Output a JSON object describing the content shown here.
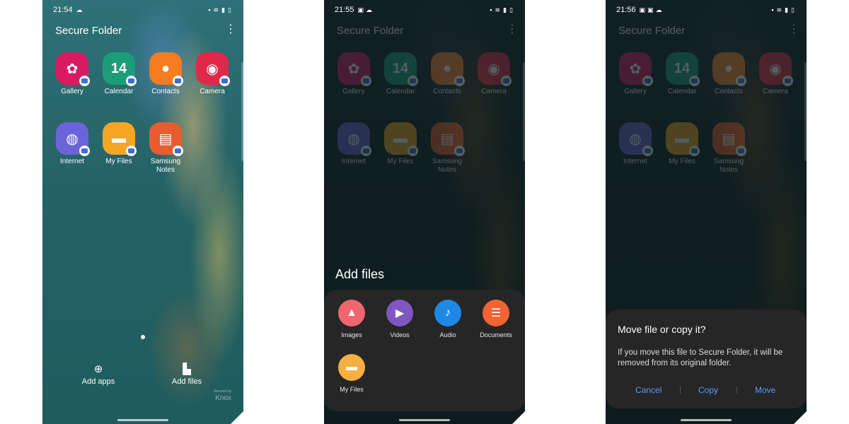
{
  "screen1": {
    "time": "21:54",
    "title": "Secure Folder",
    "apps": [
      {
        "label": "Gallery",
        "icon": "gallery-icon",
        "color": "#d81b60"
      },
      {
        "label": "Calendar",
        "icon": "calendar-icon",
        "color": "#1b9e77",
        "glyph": "14"
      },
      {
        "label": "Contacts",
        "icon": "contacts-icon",
        "color": "#f57c20"
      },
      {
        "label": "Camera",
        "icon": "camera-icon",
        "color": "#e0284a"
      },
      {
        "label": "Internet",
        "icon": "internet-icon",
        "color": "#6c63d8"
      },
      {
        "label": "My Files",
        "icon": "folder-icon",
        "color": "#f5a623"
      },
      {
        "label": "Samsung Notes",
        "label_lines": [
          "Samsung",
          "Notes"
        ],
        "icon": "notes-icon",
        "color": "#e85d2f"
      }
    ],
    "add_apps": "Add apps",
    "add_files": "Add files",
    "knox_small": "Secured by",
    "knox": "Knox"
  },
  "screen2": {
    "time": "21:55",
    "sheet_title": "Add files",
    "options": [
      {
        "label": "Images",
        "icon": "images-icon",
        "color": "#ef6670"
      },
      {
        "label": "Videos",
        "icon": "videos-icon",
        "color": "#7e57c2"
      },
      {
        "label": "Audio",
        "icon": "audio-icon",
        "color": "#1e88e5"
      },
      {
        "label": "Documents",
        "icon": "documents-icon",
        "color": "#f06434"
      },
      {
        "label": "My Files",
        "icon": "folder-icon",
        "color": "#f5b041"
      }
    ]
  },
  "screen3": {
    "time": "21:56",
    "dialog": {
      "title": "Move file or copy it?",
      "body": "If you move this file to Secure Folder, it will be removed from its original folder.",
      "cancel": "Cancel",
      "copy": "Copy",
      "move": "Move"
    },
    "accent": "#5b9cff"
  }
}
